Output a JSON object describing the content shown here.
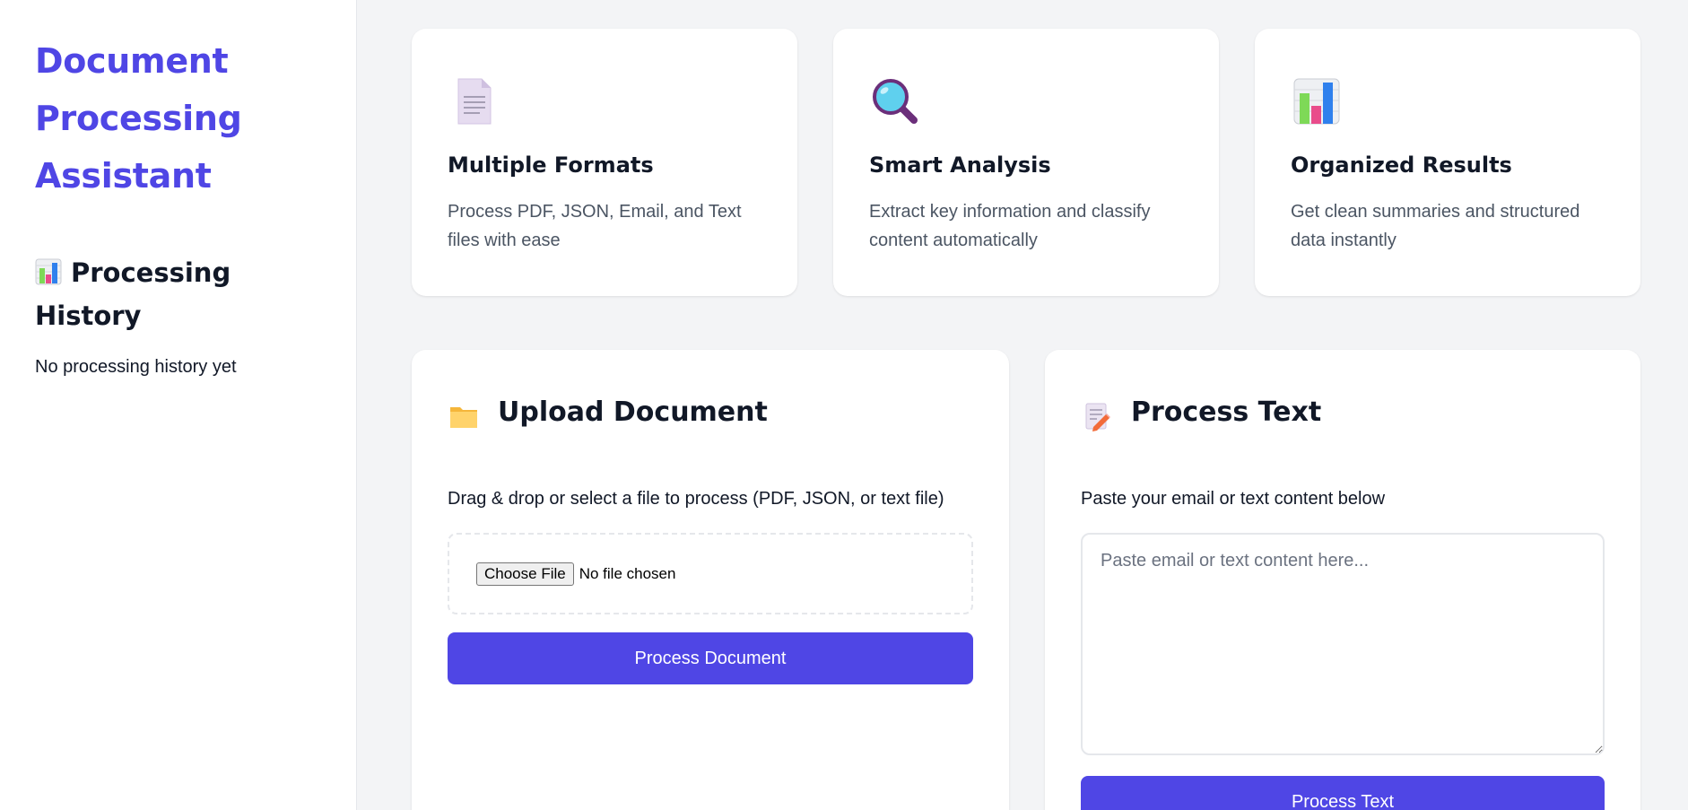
{
  "sidebar": {
    "title_lines": [
      "Document",
      "Processing",
      "Assistant"
    ],
    "history_heading_line1": "Processing",
    "history_heading_line2": "History",
    "history_icon": "bar-chart-icon",
    "history_empty": "No processing history yet"
  },
  "features": [
    {
      "icon": "document-icon",
      "title": "Multiple Formats",
      "description": "Process PDF, JSON, Email, and Text files with ease"
    },
    {
      "icon": "magnifier-icon",
      "title": "Smart Analysis",
      "description": "Extract key information and classify content automatically"
    },
    {
      "icon": "bar-chart-icon",
      "title": "Organized Results",
      "description": "Get clean summaries and structured data instantly"
    }
  ],
  "upload": {
    "icon": "folder-icon",
    "title": "Upload Document",
    "description": "Drag & drop or select a file to process (PDF, JSON, or text file)",
    "choose_file_label": "Choose File",
    "file_status": "No file chosen",
    "button_label": "Process Document"
  },
  "text": {
    "icon": "memo-icon",
    "title": "Process Text",
    "description": "Paste your email or text content below",
    "placeholder": "Paste email or text content here...",
    "button_label": "Process Text"
  },
  "colors": {
    "accent": "#4f46e5",
    "background": "#f3f4f6",
    "card": "#ffffff",
    "muted_text": "#4b5563"
  }
}
